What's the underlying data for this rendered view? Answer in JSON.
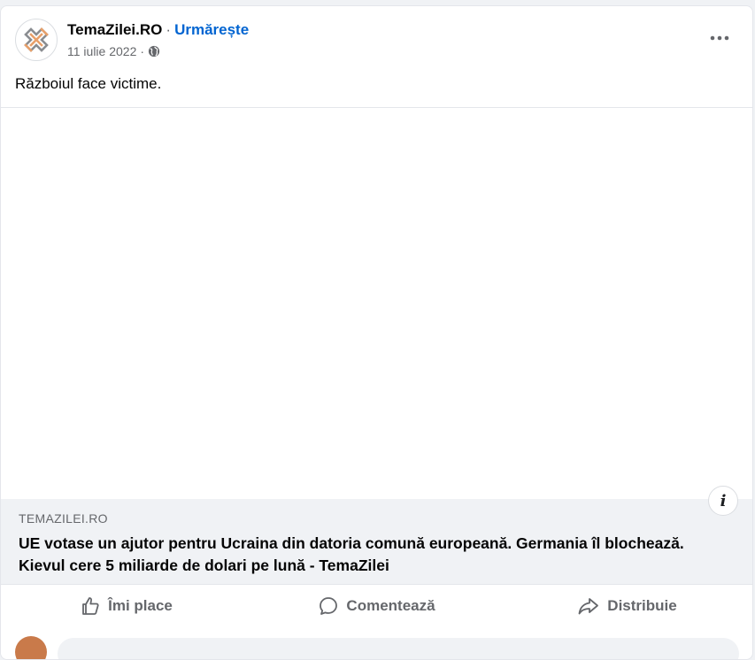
{
  "post": {
    "page_name": "TemaZilei.RO",
    "separator": "·",
    "follow_label": "Urmărește",
    "date": "11 iulie 2022",
    "date_separator": "·",
    "privacy_icon": "globe-icon",
    "more_icon": "more-options-icon",
    "text": "Războiul face victime."
  },
  "link_preview": {
    "domain": "TEMAZILEI.RO",
    "title": "UE votase un ajutor pentru Ucraina din datoria comună europeană. Germania îl blochează. Kievul cere 5 miliarde de dolari pe lună - TemaZilei",
    "info_label": "i"
  },
  "actions": {
    "like_label": "Îmi place",
    "comment_label": "Comentează",
    "share_label": "Distribuie"
  },
  "colors": {
    "accent": "#0064d1",
    "secondary_text": "#65676b",
    "logo_orange": "#e8a06a",
    "logo_gray": "#8a8d91"
  }
}
